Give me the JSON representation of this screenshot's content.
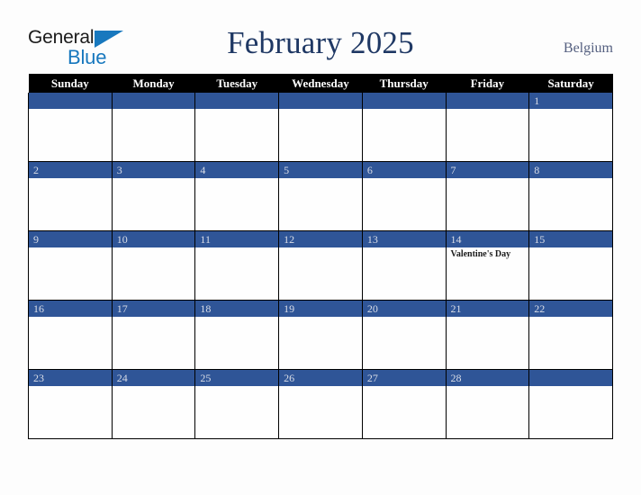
{
  "brand": {
    "word_one": "General",
    "word_two": "Blue",
    "triangle_icon": "triangle-icon",
    "accent_color": "#1878be",
    "text_color": "#1b1b1b"
  },
  "header": {
    "title": "February 2025",
    "region": "Belgium",
    "title_color": "#1f3864",
    "region_color": "#556080"
  },
  "calendar": {
    "month": "February",
    "year": "2025",
    "weekday_headers": [
      "Sunday",
      "Monday",
      "Tuesday",
      "Wednesday",
      "Thursday",
      "Friday",
      "Saturday"
    ],
    "header_bg": "#000000",
    "header_text_color": "#ffffff",
    "daynum_band_color": "#2f5597",
    "daynum_text_color": "#d9dde7",
    "grid_line_color": "#000000",
    "cell_bg": "#fefefe",
    "weeks": [
      [
        {
          "day": "",
          "event": ""
        },
        {
          "day": "",
          "event": ""
        },
        {
          "day": "",
          "event": ""
        },
        {
          "day": "",
          "event": ""
        },
        {
          "day": "",
          "event": ""
        },
        {
          "day": "",
          "event": ""
        },
        {
          "day": "1",
          "event": ""
        }
      ],
      [
        {
          "day": "2",
          "event": ""
        },
        {
          "day": "3",
          "event": ""
        },
        {
          "day": "4",
          "event": ""
        },
        {
          "day": "5",
          "event": ""
        },
        {
          "day": "6",
          "event": ""
        },
        {
          "day": "7",
          "event": ""
        },
        {
          "day": "8",
          "event": ""
        }
      ],
      [
        {
          "day": "9",
          "event": ""
        },
        {
          "day": "10",
          "event": ""
        },
        {
          "day": "11",
          "event": ""
        },
        {
          "day": "12",
          "event": ""
        },
        {
          "day": "13",
          "event": ""
        },
        {
          "day": "14",
          "event": "Valentine's Day"
        },
        {
          "day": "15",
          "event": ""
        }
      ],
      [
        {
          "day": "16",
          "event": ""
        },
        {
          "day": "17",
          "event": ""
        },
        {
          "day": "18",
          "event": ""
        },
        {
          "day": "19",
          "event": ""
        },
        {
          "day": "20",
          "event": ""
        },
        {
          "day": "21",
          "event": ""
        },
        {
          "day": "22",
          "event": ""
        }
      ],
      [
        {
          "day": "23",
          "event": ""
        },
        {
          "day": "24",
          "event": ""
        },
        {
          "day": "25",
          "event": ""
        },
        {
          "day": "26",
          "event": ""
        },
        {
          "day": "27",
          "event": ""
        },
        {
          "day": "28",
          "event": ""
        },
        {
          "day": "",
          "event": ""
        }
      ]
    ]
  }
}
